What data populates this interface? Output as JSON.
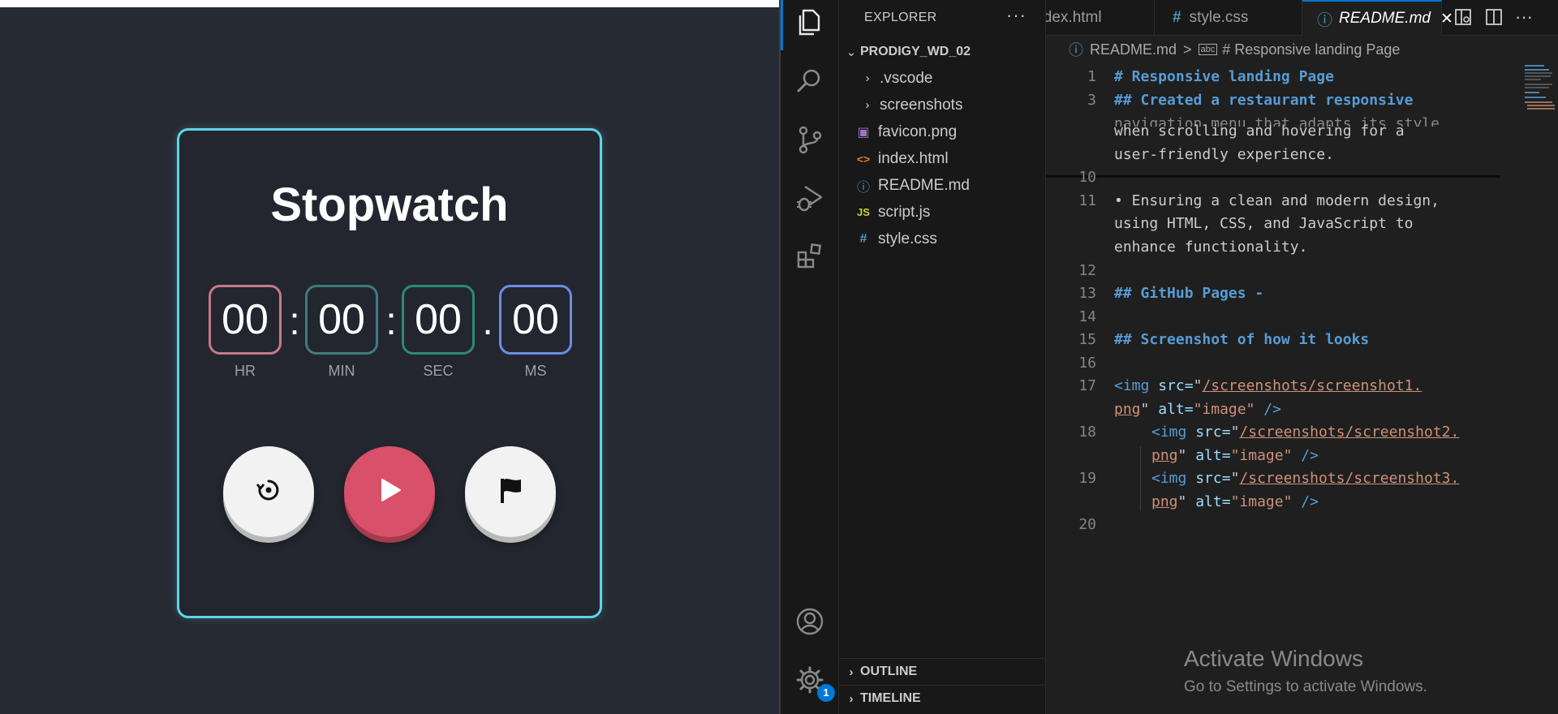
{
  "stopwatch": {
    "title": "Stopwatch",
    "units": [
      {
        "value": "00",
        "label": "HR",
        "color": "#c47a86"
      },
      {
        "value": "00",
        "label": "MIN",
        "color": "#3f7a7f"
      },
      {
        "value": "00",
        "label": "SEC",
        "color": "#2a8a7a"
      },
      {
        "value": "00",
        "label": "MS",
        "color": "#6b8de3"
      }
    ],
    "separators": [
      ":",
      ":",
      "."
    ],
    "buttons": {
      "reset": "reset-icon",
      "start": "play-icon",
      "lap": "flag-icon"
    },
    "accent": "#5fd3ea",
    "start_color": "#d9506a"
  },
  "vscode": {
    "explorer_title": "EXPLORER",
    "explorer_more": "···",
    "project": "PRODIGY_WD_02",
    "tree": [
      {
        "name": ".vscode",
        "type": "folder",
        "icon": ""
      },
      {
        "name": "screenshots",
        "type": "folder",
        "icon": ""
      },
      {
        "name": "favicon.png",
        "type": "file",
        "icon": "▣"
      },
      {
        "name": "index.html",
        "type": "file",
        "icon": "<>"
      },
      {
        "name": "README.md",
        "type": "file",
        "icon": "ⓘ"
      },
      {
        "name": "script.js",
        "type": "file",
        "icon": "JS"
      },
      {
        "name": "style.css",
        "type": "file",
        "icon": "#"
      }
    ],
    "sections": [
      "OUTLINE",
      "TIMELINE"
    ],
    "tabs": [
      {
        "label": "index.html",
        "icon": ""
      },
      {
        "label": "style.css",
        "icon": "#"
      },
      {
        "label": "README.md",
        "icon": "ⓘ",
        "close": "✕"
      }
    ],
    "breadcrumb": {
      "file": "README.md",
      "separator": ">",
      "symbol": "# Responsive landing Page"
    },
    "sticky_lines": [
      {
        "n": "1",
        "text": "# Responsive landing Page"
      },
      {
        "n": "3",
        "text": "## Created a restaurant responsive"
      }
    ],
    "lines": [
      {
        "n": "",
        "text": "navigation menu that adapts its style"
      },
      {
        "n": "",
        "text": "when scrolling and hovering for a"
      },
      {
        "n": "",
        "text": "user-friendly experience."
      },
      {
        "n": "10",
        "text": ""
      },
      {
        "n": "11",
        "text": "• Ensuring a clean and modern design,"
      },
      {
        "n": "",
        "text": "using HTML, CSS, and JavaScript to"
      },
      {
        "n": "",
        "text": "enhance functionality."
      },
      {
        "n": "12",
        "text": ""
      },
      {
        "n": "13",
        "text": "## GitHub Pages -"
      },
      {
        "n": "14",
        "text": ""
      },
      {
        "n": "15",
        "text": "## Screenshot of how it looks"
      },
      {
        "n": "16",
        "text": ""
      },
      {
        "n": "17",
        "text": ""
      },
      {
        "n": "",
        "text": ""
      },
      {
        "n": "18",
        "text": ""
      },
      {
        "n": "",
        "text": ""
      },
      {
        "n": "19",
        "text": ""
      },
      {
        "n": "",
        "text": ""
      },
      {
        "n": "20",
        "text": ""
      }
    ],
    "img_lines": [
      {
        "n": "17",
        "indent": "",
        "src": "/screenshots/screenshot1.",
        "cont": "png"
      },
      {
        "n": "18",
        "indent": "    ",
        "src": "/screenshots/screenshot2.",
        "cont": "png"
      },
      {
        "n": "19",
        "indent": "    ",
        "src": "/screenshots/screenshot3.",
        "cont": "png"
      }
    ],
    "img_parts": {
      "open": "<img",
      "src_attr": "src=",
      "alt_attr": "alt=",
      "alt_val": "\"image\"",
      "close": "/>",
      "quote": "\""
    },
    "watermark": {
      "title": "Activate Windows",
      "subtitle": "Go to Settings to activate Windows."
    },
    "notification_badge": "1"
  }
}
